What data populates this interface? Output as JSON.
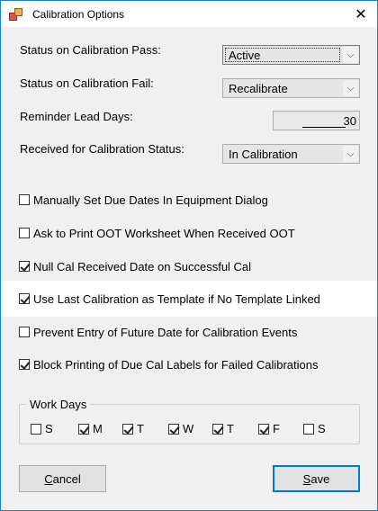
{
  "window": {
    "title": "Calibration Options",
    "close_glyph": "✕"
  },
  "settings": {
    "pass_status": {
      "label": "Status on Calibration Pass:",
      "value": "Active"
    },
    "fail_status": {
      "label": "Status on Calibration Fail:",
      "value": "Recalibrate"
    },
    "reminder": {
      "label": "Reminder Lead Days:",
      "value": "30"
    },
    "received_status": {
      "label": "Received for Calibration Status:",
      "value": "In Calibration"
    }
  },
  "options": [
    {
      "label": "Manually Set Due Dates In Equipment Dialog",
      "checked": false
    },
    {
      "label": "Ask to Print OOT Worksheet When Received OOT",
      "checked": false
    },
    {
      "label": "Null Cal Received Date on Successful Cal",
      "checked": true
    },
    {
      "label": "Use Last Calibration as Template if No Template Linked",
      "checked": true
    },
    {
      "label": "Prevent Entry of Future Date for Calibration Events",
      "checked": false
    },
    {
      "label": "Block Printing of Due Cal Labels for Failed Calibrations",
      "checked": true
    }
  ],
  "work_days": {
    "title": "Work Days",
    "days": [
      {
        "label": "S",
        "checked": false
      },
      {
        "label": "M",
        "checked": true
      },
      {
        "label": "T",
        "checked": true
      },
      {
        "label": "W",
        "checked": true
      },
      {
        "label": "T",
        "checked": true
      },
      {
        "label": "F",
        "checked": true
      },
      {
        "label": "S",
        "checked": false
      }
    ]
  },
  "buttons": {
    "cancel": {
      "first": "C",
      "rest": "ancel"
    },
    "save": {
      "first": "S",
      "rest": "ave"
    }
  },
  "colors": {
    "accent": "#0078d7",
    "background": "#f0f0f0"
  }
}
